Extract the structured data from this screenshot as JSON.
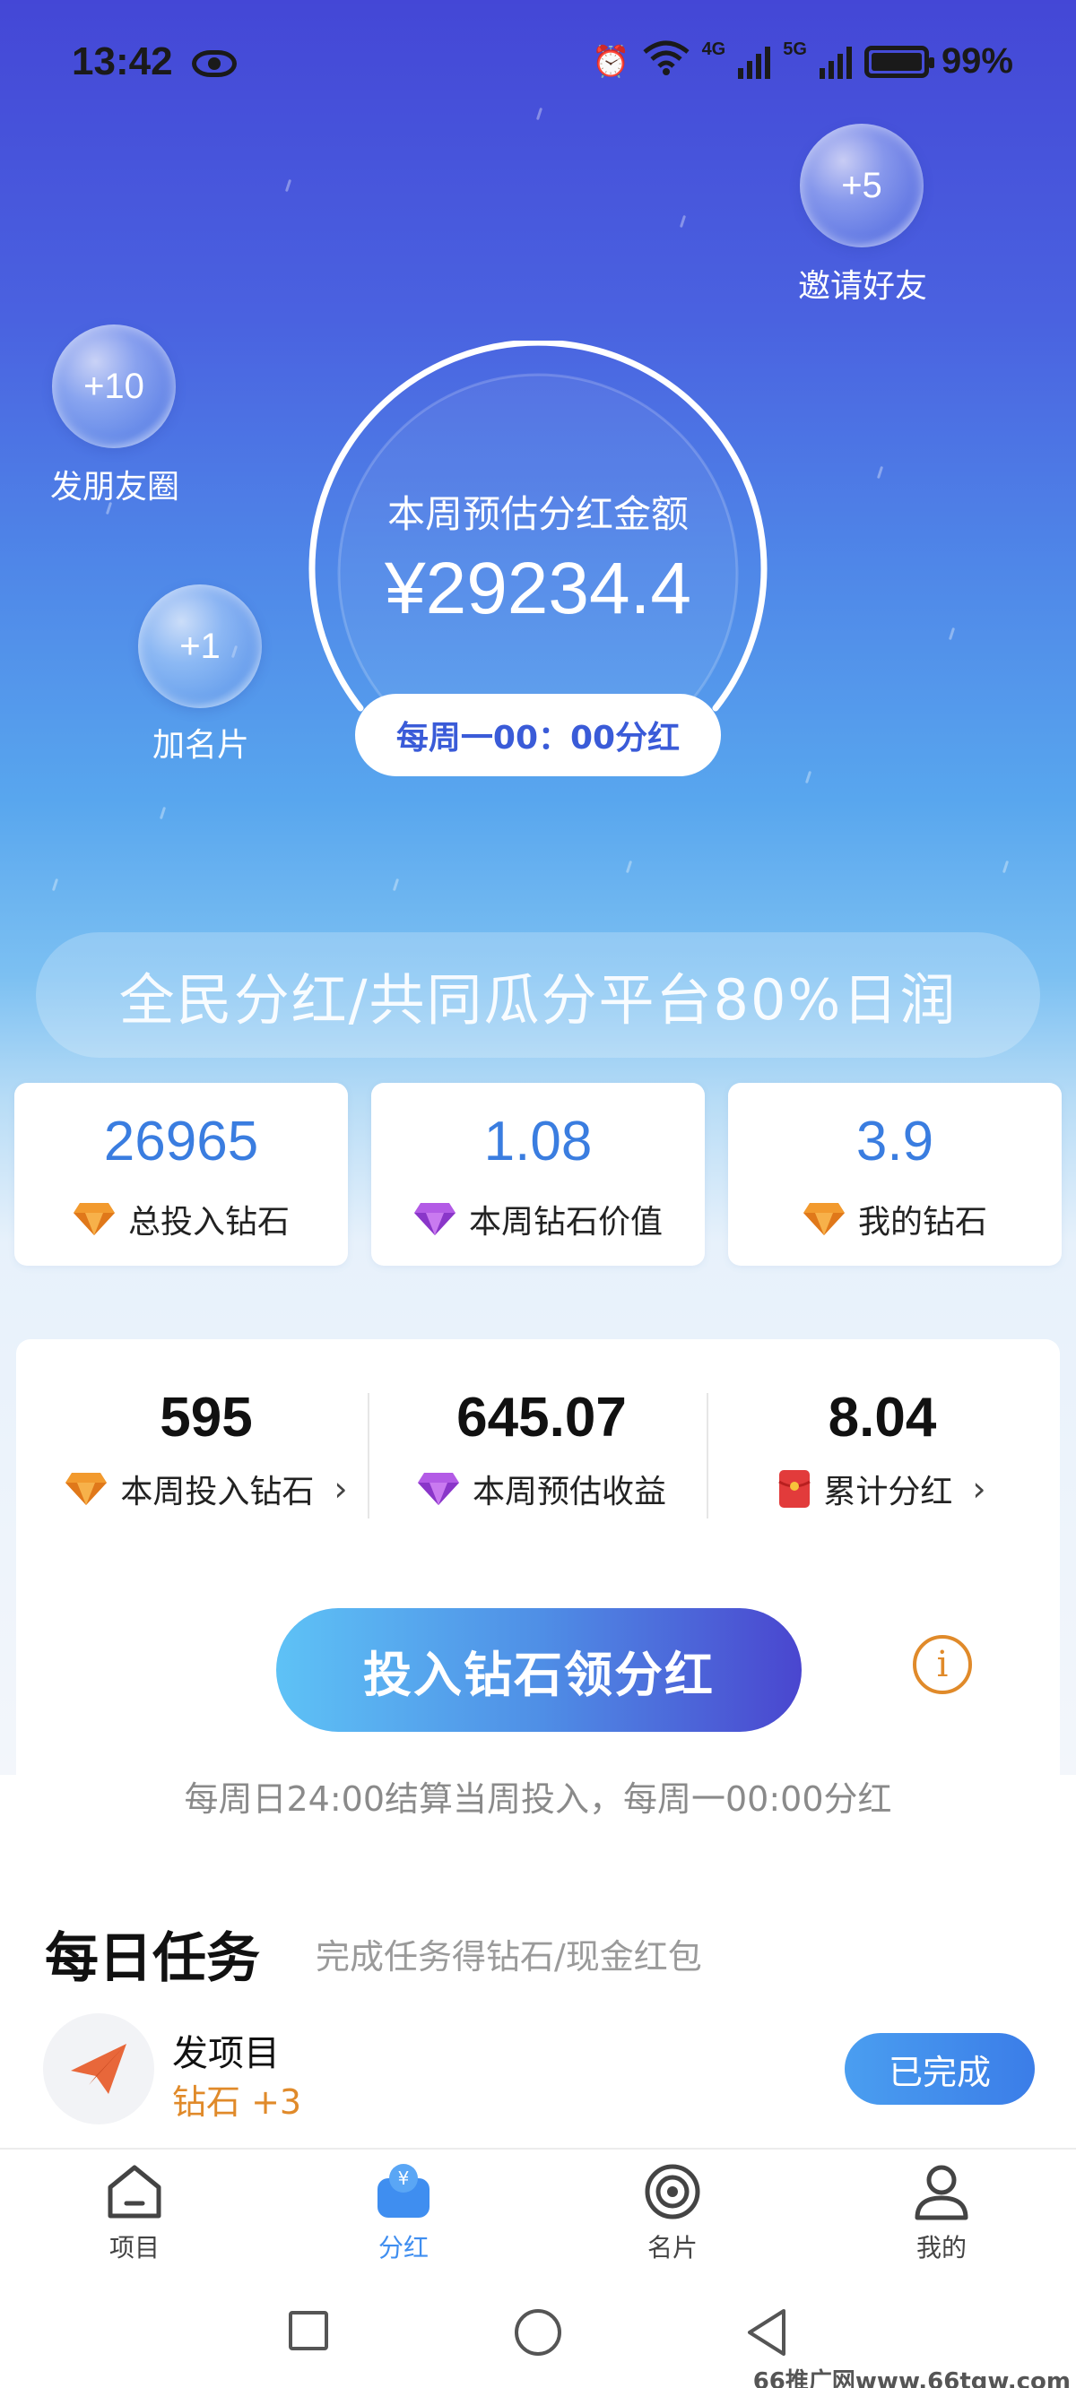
{
  "status_bar": {
    "time": "13:42",
    "battery": "99%",
    "network_4g": "4G",
    "network_5g": "5G"
  },
  "bubbles": [
    {
      "value": "+5",
      "label": "邀请好友"
    },
    {
      "value": "+10",
      "label": "发朋友圈"
    },
    {
      "value": "+1",
      "label": "加名片"
    }
  ],
  "gauge": {
    "title": "本周预估分红金额",
    "amount": "¥29234.4",
    "schedule": "每周一00：00分红"
  },
  "slogan": "全民分红/共同瓜分平台80%日润",
  "stat_cards": [
    {
      "value": "26965",
      "label": "总投入钻石",
      "icon": "orange-diamond-icon"
    },
    {
      "value": "1.08",
      "label": "本周钻石价值",
      "icon": "purple-diamond-icon"
    },
    {
      "value": "3.9",
      "label": "我的钻石",
      "icon": "orange-diamond-icon"
    }
  ],
  "panel_stats": [
    {
      "value": "595",
      "label": "本周投入钻石",
      "icon": "orange-diamond-icon",
      "chevron": "›"
    },
    {
      "value": "645.07",
      "label": "本周预估收益",
      "icon": "purple-diamond-icon"
    },
    {
      "value": "8.04",
      "label": "累计分红",
      "icon": "red-envelope-icon",
      "chevron": "›"
    }
  ],
  "cta": {
    "label": "投入钻石领分红",
    "info_icon": "i"
  },
  "note": "每周日24:00结算当周投入，每周一00:00分红",
  "daily_tasks": {
    "title": "每日任务",
    "subtitle": "完成任务得钻石/现金红包",
    "items": [
      {
        "name": "发项目",
        "reward": "钻石 +3",
        "status": "已完成",
        "icon": "paper-plane-icon"
      }
    ]
  },
  "tabs": [
    {
      "label": "项目",
      "icon": "home-icon",
      "active": false
    },
    {
      "label": "分红",
      "icon": "yen-bag-icon",
      "active": true
    },
    {
      "label": "名片",
      "icon": "target-icon",
      "active": false
    },
    {
      "label": "我的",
      "icon": "user-icon",
      "active": false
    }
  ],
  "watermark": "66推广网www.66tgw.com",
  "colors": {
    "accent_blue": "#3a7de0",
    "orange": "#e08a2a",
    "hero_top": "#4447d6",
    "tab_active": "#3f8ef0"
  }
}
